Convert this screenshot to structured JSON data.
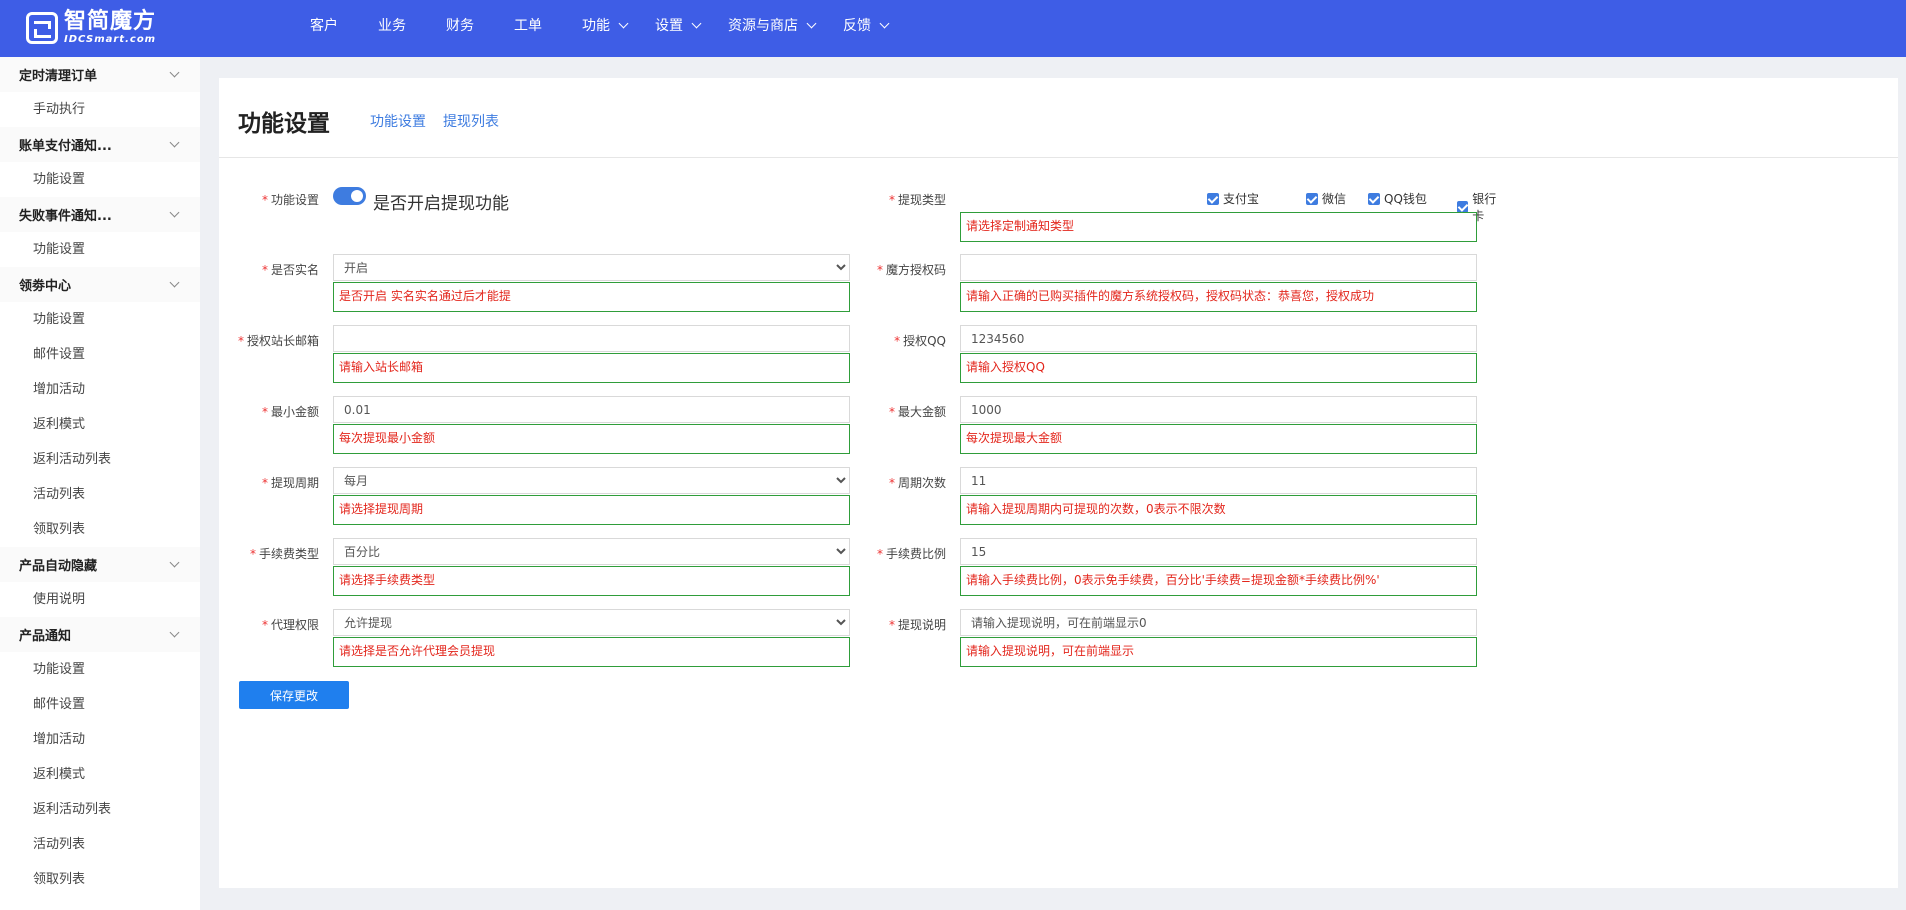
{
  "brand": {
    "name_cn": "智简魔方",
    "name_en": "IDCSmart.com"
  },
  "nav": [
    {
      "label": "客户",
      "dropdown": false
    },
    {
      "label": "业务",
      "dropdown": false
    },
    {
      "label": "财务",
      "dropdown": false
    },
    {
      "label": "工单",
      "dropdown": false
    },
    {
      "label": "功能",
      "dropdown": true
    },
    {
      "label": "设置",
      "dropdown": true
    },
    {
      "label": "资源与商店",
      "dropdown": true
    },
    {
      "label": "反馈",
      "dropdown": true
    }
  ],
  "sidebar": [
    {
      "type": "group",
      "label": "定时清理订单"
    },
    {
      "type": "item",
      "label": "手动执行"
    },
    {
      "type": "group",
      "label": "账单支付通知..."
    },
    {
      "type": "item",
      "label": "功能设置"
    },
    {
      "type": "group",
      "label": "失败事件通知..."
    },
    {
      "type": "item",
      "label": "功能设置"
    },
    {
      "type": "group",
      "label": "领劵中心"
    },
    {
      "type": "item",
      "label": "功能设置"
    },
    {
      "type": "item",
      "label": "邮件设置"
    },
    {
      "type": "item",
      "label": "增加活动"
    },
    {
      "type": "item",
      "label": "返利模式"
    },
    {
      "type": "item",
      "label": "返利活动列表"
    },
    {
      "type": "item",
      "label": "活动列表"
    },
    {
      "type": "item",
      "label": "领取列表"
    },
    {
      "type": "group",
      "label": "产品自动隐藏"
    },
    {
      "type": "item",
      "label": "使用说明"
    },
    {
      "type": "group",
      "label": "产品通知"
    },
    {
      "type": "item",
      "label": "功能设置"
    },
    {
      "type": "item",
      "label": "邮件设置"
    },
    {
      "type": "item",
      "label": "增加活动"
    },
    {
      "type": "item",
      "label": "返利模式"
    },
    {
      "type": "item",
      "label": "返利活动列表"
    },
    {
      "type": "item",
      "label": "活动列表"
    },
    {
      "type": "item",
      "label": "领取列表"
    }
  ],
  "page": {
    "title": "功能设置",
    "tabs": [
      "功能设置",
      "提现列表"
    ]
  },
  "form": {
    "feature": {
      "label": "功能设置",
      "toggle_label": "是否开启提现功能",
      "enabled": true
    },
    "withdraw_type": {
      "label": "提现类型",
      "options": [
        {
          "label": "支付宝",
          "checked": true
        },
        {
          "label": "微信",
          "checked": true
        },
        {
          "label": "QQ钱包",
          "checked": true
        },
        {
          "label": "银行卡",
          "checked": true
        }
      ],
      "hint": "请选择定制通知类型"
    },
    "real_name": {
      "label": "是否实名",
      "value": "开启",
      "hint": "是否开启 实名实名通过后才能提"
    },
    "auth_code": {
      "label": "魔方授权码",
      "value": "",
      "hint": "请输入正确的已购买插件的魔方系统授权码，授权码状态：恭喜您，授权成功"
    },
    "admin_email": {
      "label": "授权站长邮箱",
      "value": "",
      "hint": "请输入站长邮箱"
    },
    "auth_qq": {
      "label": "授权QQ",
      "value": "1234560",
      "hint": "请输入授权QQ"
    },
    "min_amount": {
      "label": "最小金额",
      "value": "0.01",
      "hint": "每次提现最小金额"
    },
    "max_amount": {
      "label": "最大金额",
      "value": "1000",
      "hint": "每次提现最大金额"
    },
    "period": {
      "label": "提现周期",
      "value": "每月",
      "hint": "请选择提现周期"
    },
    "period_count": {
      "label": "周期次数",
      "value": "11",
      "hint": "请输入提现周期内可提现的次数，0表示不限次数"
    },
    "fee_type": {
      "label": "手续费类型",
      "value": "百分比",
      "hint": "请选择手续费类型"
    },
    "fee_ratio": {
      "label": "手续费比例",
      "value": "15",
      "hint": "请输入手续费比例，0表示免手续费，百分比'手续费=提现金额*手续费比例%'"
    },
    "agent": {
      "label": "代理权限",
      "value": "允许提现",
      "hint": "请选择是否允许代理会员提现"
    },
    "note": {
      "label": "提现说明",
      "value": "请输入提现说明，可在前端显示0",
      "hint": "请输入提现说明，可在前端显示"
    },
    "save_label": "保存更改"
  },
  "colors": {
    "topbar": "#3e5de6",
    "accent": "#3e7ce0",
    "hint_border": "#2f9d3a",
    "hint_text": "#e3261c"
  }
}
